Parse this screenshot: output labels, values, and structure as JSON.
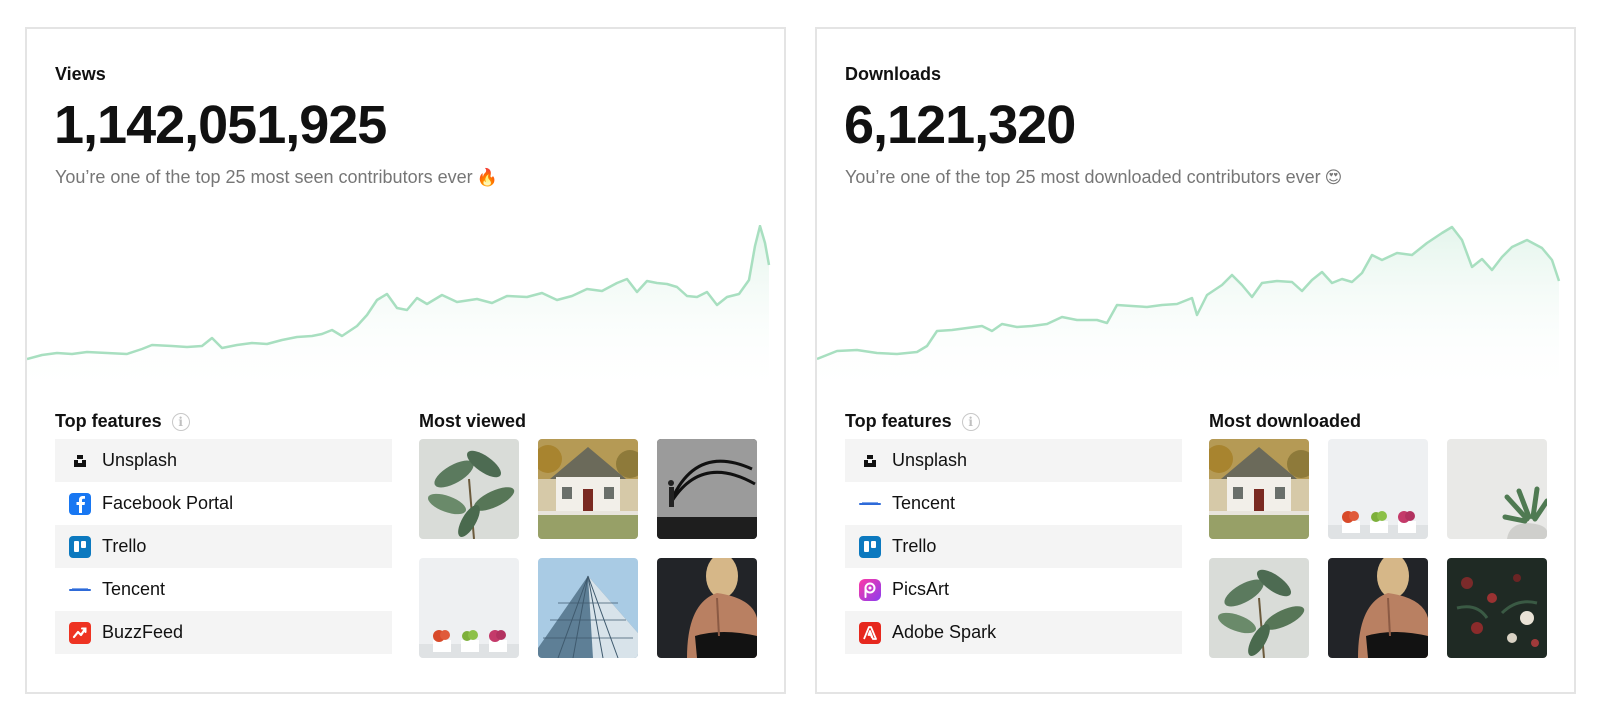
{
  "views": {
    "label": "Views",
    "total": "1,142,051,925",
    "subtitle": "You’re one of the top 25 most seen contributors ever",
    "subtitle_emoji": "🔥",
    "features_title": "Top features",
    "gallery_title": "Most viewed",
    "features": [
      {
        "name": "Unsplash",
        "icon": "unsplash-icon"
      },
      {
        "name": "Facebook Portal",
        "icon": "facebook-icon"
      },
      {
        "name": "Trello",
        "icon": "trello-icon"
      },
      {
        "name": "Tencent",
        "icon": "tencent-icon"
      },
      {
        "name": "BuzzFeed",
        "icon": "buzzfeed-icon"
      }
    ],
    "photos": [
      "plant-photo",
      "house-photo",
      "fitness-rope-photo",
      "flower-pots-photo",
      "building-photo",
      "athlete-back-photo"
    ]
  },
  "downloads": {
    "label": "Downloads",
    "total": "6,121,320",
    "subtitle": "You’re one of the top 25 most downloaded contributors ever",
    "subtitle_emoji": "😍",
    "features_title": "Top features",
    "gallery_title": "Most downloaded",
    "features": [
      {
        "name": "Unsplash",
        "icon": "unsplash-icon"
      },
      {
        "name": "Tencent",
        "icon": "tencent-icon"
      },
      {
        "name": "Trello",
        "icon": "trello-icon"
      },
      {
        "name": "PicsArt",
        "icon": "picsart-icon"
      },
      {
        "name": "Adobe Spark",
        "icon": "adobe-spark-icon"
      }
    ],
    "photos": [
      "house-photo",
      "flower-pots-photo",
      "succulent-photo",
      "plant-photo",
      "athlete-back-photo",
      "dark-flowers-photo"
    ]
  },
  "colors": {
    "chart_line": "#a8dfc0",
    "chart_fill": "#eaf7f0",
    "row_shade": "#f4f4f4",
    "muted_text": "#767676",
    "card_border": "#e4e4e4"
  }
}
